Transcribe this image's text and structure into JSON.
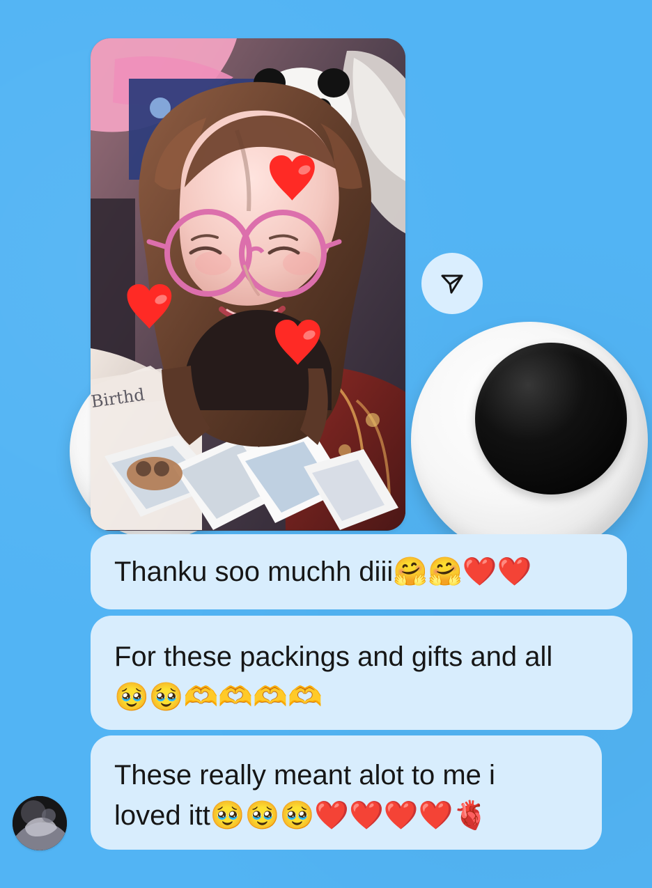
{
  "media_message": {
    "decorations": [
      "heart-icon",
      "heart-icon",
      "heart-icon"
    ],
    "sticker_text": "Birthd"
  },
  "actions": {
    "share_icon": "send-icon"
  },
  "messages": [
    {
      "text": "Thanku soo muchh diii🤗🤗❤️❤️"
    },
    {
      "text": "For these packings and gifts and all\n🥹🥹🫶🫶🫶🫶"
    },
    {
      "text": "These really meant alot to me i\nloved itt🥹🥹🥹❤️❤️❤️❤️🫀"
    }
  ],
  "colors": {
    "background": "#52b4f4",
    "bubble": "#d8edfd",
    "text": "#161616",
    "share_button": "#daeefe"
  }
}
